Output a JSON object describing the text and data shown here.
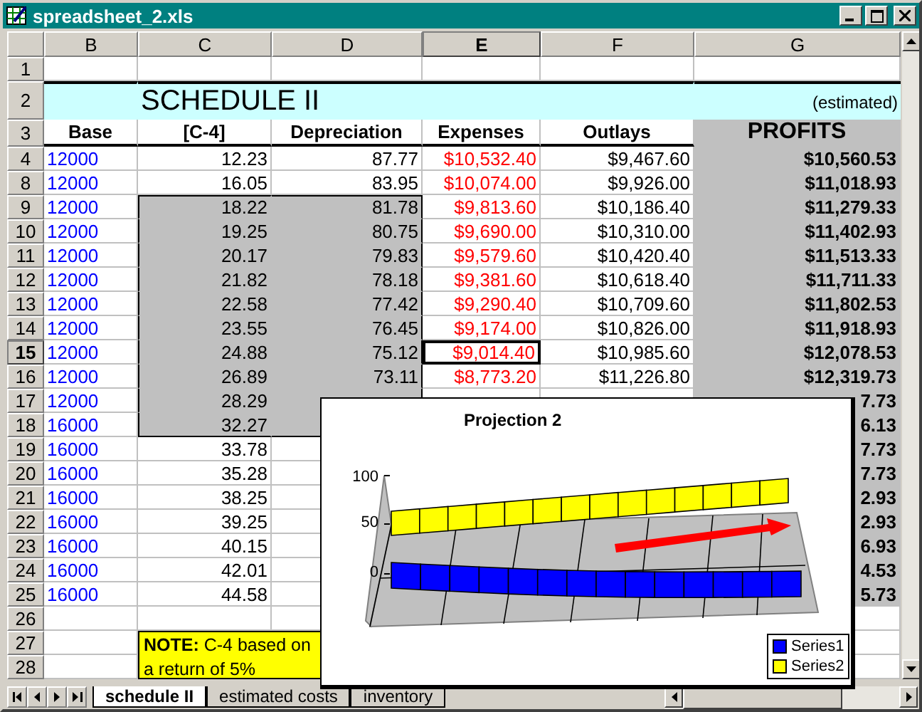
{
  "window": {
    "title": "spreadsheet_2.xls"
  },
  "columns": [
    {
      "label": "B",
      "selected": false
    },
    {
      "label": "C",
      "selected": false
    },
    {
      "label": "D",
      "selected": false
    },
    {
      "label": "E",
      "selected": true
    },
    {
      "label": "F",
      "selected": false
    },
    {
      "label": "G",
      "selected": false
    }
  ],
  "rows": [
    {
      "number": "1",
      "kind": "blank",
      "selected": false
    },
    {
      "number": "2",
      "kind": "title",
      "selected": false,
      "cells": {
        "C": "SCHEDULE II",
        "G": "(estimated)"
      }
    },
    {
      "number": "3",
      "kind": "header",
      "selected": false,
      "cells": {
        "B": "Base",
        "C": "[C-4]",
        "D": "Depreciation",
        "E": "Expenses",
        "F": "Outlays",
        "G": "PROFITS"
      }
    },
    {
      "number": "4",
      "kind": "data",
      "selected": false,
      "shaded": false,
      "cells": {
        "B": "12000",
        "C": "12.23",
        "D": "87.77",
        "E": "$10,532.40",
        "F": "$9,467.60",
        "G": "$10,560.53"
      }
    },
    {
      "number": "8",
      "kind": "data",
      "selected": false,
      "shaded": false,
      "cells": {
        "B": "12000",
        "C": "16.05",
        "D": "83.95",
        "E": "$10,074.00",
        "F": "$9,926.00",
        "G": "$11,018.93"
      }
    },
    {
      "number": "9",
      "kind": "data",
      "selected": false,
      "shaded": true,
      "cells": {
        "B": "12000",
        "C": "18.22",
        "D": "81.78",
        "E": "$9,813.60",
        "F": "$10,186.40",
        "G": "$11,279.33"
      }
    },
    {
      "number": "10",
      "kind": "data",
      "selected": false,
      "shaded": true,
      "cells": {
        "B": "12000",
        "C": "19.25",
        "D": "80.75",
        "E": "$9,690.00",
        "F": "$10,310.00",
        "G": "$11,402.93"
      }
    },
    {
      "number": "11",
      "kind": "data",
      "selected": false,
      "shaded": true,
      "cells": {
        "B": "12000",
        "C": "20.17",
        "D": "79.83",
        "E": "$9,579.60",
        "F": "$10,420.40",
        "G": "$11,513.33"
      }
    },
    {
      "number": "12",
      "kind": "data",
      "selected": false,
      "shaded": true,
      "cells": {
        "B": "12000",
        "C": "21.82",
        "D": "78.18",
        "E": "$9,381.60",
        "F": "$10,618.40",
        "G": "$11,711.33"
      }
    },
    {
      "number": "13",
      "kind": "data",
      "selected": false,
      "shaded": true,
      "cells": {
        "B": "12000",
        "C": "22.58",
        "D": "77.42",
        "E": "$9,290.40",
        "F": "$10,709.60",
        "G": "$11,802.53"
      }
    },
    {
      "number": "14",
      "kind": "data",
      "selected": false,
      "shaded": true,
      "cells": {
        "B": "12000",
        "C": "23.55",
        "D": "76.45",
        "E": "$9,174.00",
        "F": "$10,826.00",
        "G": "$11,918.93"
      }
    },
    {
      "number": "15",
      "kind": "data",
      "selected": true,
      "shaded": true,
      "cells": {
        "B": "12000",
        "C": "24.88",
        "D": "75.12",
        "E": "$9,014.40",
        "F": "$10,985.60",
        "G": "$12,078.53"
      }
    },
    {
      "number": "16",
      "kind": "data",
      "selected": false,
      "shaded": true,
      "cells": {
        "B": "12000",
        "C": "26.89",
        "D": "73.11",
        "E": "$8,773.20",
        "F": "$11,226.80",
        "G": "$12,319.73"
      }
    },
    {
      "number": "17",
      "kind": "data",
      "selected": false,
      "shaded": true,
      "cells": {
        "B": "12000",
        "C": "28.29",
        "G": "7.73"
      }
    },
    {
      "number": "18",
      "kind": "data",
      "selected": false,
      "shaded": true,
      "cells": {
        "B": "16000",
        "C": "32.27",
        "G": "6.13"
      }
    },
    {
      "number": "19",
      "kind": "data",
      "selected": false,
      "shaded": false,
      "cells": {
        "B": "16000",
        "C": "33.78",
        "G": "7.73"
      }
    },
    {
      "number": "20",
      "kind": "data",
      "selected": false,
      "shaded": false,
      "cells": {
        "B": "16000",
        "C": "35.28",
        "G": "7.73"
      }
    },
    {
      "number": "21",
      "kind": "data",
      "selected": false,
      "shaded": false,
      "cells": {
        "B": "16000",
        "C": "38.25",
        "G": "2.93"
      }
    },
    {
      "number": "22",
      "kind": "data",
      "selected": false,
      "shaded": false,
      "cells": {
        "B": "16000",
        "C": "39.25",
        "G": "2.93"
      }
    },
    {
      "number": "23",
      "kind": "data",
      "selected": false,
      "shaded": false,
      "cells": {
        "B": "16000",
        "C": "40.15",
        "G": "6.93"
      }
    },
    {
      "number": "24",
      "kind": "data",
      "selected": false,
      "shaded": false,
      "cells": {
        "B": "16000",
        "C": "42.01",
        "G": "4.53"
      }
    },
    {
      "number": "25",
      "kind": "data",
      "selected": false,
      "shaded": false,
      "cells": {
        "B": "16000",
        "C": "44.58",
        "G": "5.73"
      }
    },
    {
      "number": "26",
      "kind": "blank",
      "selected": false
    },
    {
      "number": "27",
      "kind": "note",
      "selected": false,
      "cells": {
        "C": "**NOTE:** C-4 based on\na return of 5%"
      }
    },
    {
      "number": "28",
      "kind": "blank",
      "selected": false
    }
  ],
  "chart": {
    "title": "Projection 2",
    "ticks": [
      "100",
      "50",
      "0"
    ],
    "legend": [
      {
        "name": "Series1",
        "color": "#0000ff"
      },
      {
        "name": "Series2",
        "color": "#ffff00"
      }
    ]
  },
  "sheet_tabs": [
    {
      "label": "schedule II",
      "selected": true
    },
    {
      "label": "estimated costs",
      "selected": false
    },
    {
      "label": "inventory",
      "selected": false
    }
  ]
}
